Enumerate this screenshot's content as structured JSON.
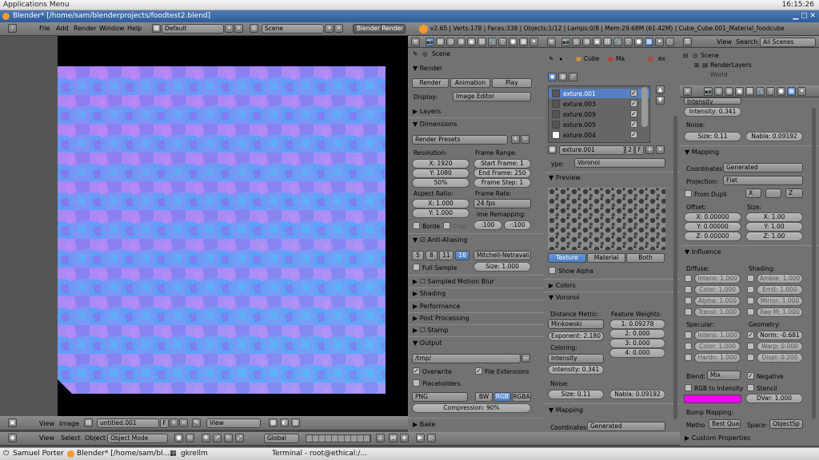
{
  "top_panel": {
    "applications_menu": "Applications Menu",
    "clock": "16:15:26"
  },
  "window": {
    "title": "Blender* [/home/sam/blenderprojects/foodtest2.blend]"
  },
  "menu": {
    "file": "File",
    "add": "Add",
    "render": "Render",
    "window": "Window",
    "help": "Help",
    "layout": "Default",
    "scene": "Scene",
    "engine": "Blender Render",
    "stats": "v2.65 | Verts:178 | Faces:338 | Objects:1/12 | Lamps:0/8 | Mem:29.68M (61.42M) | Cube_Cube.001_Material_foodcube"
  },
  "image_editor_header": {
    "view": "View",
    "image": "Image",
    "image_name": "untitled.001",
    "f": "F",
    "view2": "View"
  },
  "view3d_header": {
    "view": "View",
    "select": "Select",
    "object": "Object",
    "mode": "Object Mode",
    "orientation": "Global"
  },
  "render_panel": {
    "breadcrumb": "Scene",
    "render_title": "Render",
    "render_btn": "Render",
    "animation_btn": "Animation",
    "play_btn": "Play",
    "display_label": "Display:",
    "display_value": "Image Editor",
    "layers": "Layers",
    "dimensions": "Dimensions",
    "presets": "Render Presets",
    "resolution_label": "Resolution:",
    "res_x": "X: 1920",
    "res_y": "Y: 1080",
    "res_pct": "50%",
    "frame_range_label": "Frame Range:",
    "start_frame": "Start Frame: 1",
    "end_frame": "End Frame: 250",
    "frame_step": "Frame Step: 1",
    "aspect_label": "Aspect Ratio:",
    "aspect_x": "X: 1.000",
    "aspect_y": "Y: 1.000",
    "frame_rate_label": "Frame Rate:",
    "fps": "24 fps",
    "time_remap_label": "ime Remapping:",
    "remap_old": ":100",
    "remap_new": "·:100",
    "border": "Borde",
    "crop": "Crop",
    "aa": "Anti-Aliasing",
    "aa5": "5",
    "aa8": "8",
    "aa11": "11",
    "aa16": "16",
    "aa_filter": "Mitchell-Netravali",
    "full_sample": "Full Sample",
    "aa_size": "Size: 1.000",
    "motion_blur": "Sampled Motion Blur",
    "shading": "Shading",
    "performance": "Performance",
    "post": "Post Processing",
    "stamp": "Stamp",
    "output": "Output",
    "output_path": "/tmp/",
    "overwrite": "Overwrite",
    "file_ext": "File Extensions",
    "placeholders": "Placeholders",
    "format": "PNG",
    "bw": "BW",
    "rgb": "RGB",
    "rgba": "RGBA",
    "compression": "Compression: 90%",
    "bake": "Bake"
  },
  "texture_panel": {
    "breadcrumb_cube": "Cube",
    "breadcrumb_ma": "Ma",
    "breadcrumb_ex": "ex",
    "slots": [
      "exture.001",
      "exture.003",
      "exture.009",
      "exture.005",
      "exture.004"
    ],
    "tex_name": "exture.001",
    "users": "2",
    "f": "F",
    "type_label": "ype:",
    "type_value": "Voronoi",
    "preview": "Preview",
    "tab_texture": "Texture",
    "tab_material": "Material",
    "tab_both": "Both",
    "show_alpha": "Show Alpha",
    "colors": "Colors",
    "voronoi": "Voronoi",
    "distance_label": "Distance Metric:",
    "distance_value": "Minkowski",
    "exponent": "Exponent: 2.180",
    "coloring_label": "Coloring:",
    "coloring_value": "Intensity",
    "intensity": "Intensity: 0.341",
    "weights_label": "Feature Weights:",
    "w1": "1: 0.09278",
    "w2": "2: 0.000",
    "w3": "3: 0.000",
    "w4": "4: 0.000",
    "noise_label": "Noise:",
    "size": "Size: 0.11",
    "nabla": "Nabla: 0.09192",
    "mapping": "Mapping",
    "coordinates_label": "Coordinates:",
    "coordinates_value": "Generated"
  },
  "outliner": {
    "view": "View",
    "search": "Search",
    "all_scenes": "All Scenes",
    "scene": "Scene",
    "render_layers": "RenderLayers",
    "world": "World"
  },
  "props_right": {
    "intensity_top": "Intensity",
    "intensity": "Intensity: 0.341",
    "noise_label": "Noise:",
    "size": "Size: 0.11",
    "nabla": "Nabla: 0.09192",
    "mapping": "Mapping",
    "coordinates_label": "Coordinates:",
    "coordinates_value": "Generated",
    "projection_label": "Projection:",
    "projection_value": "Flat",
    "from_dupli": "From Dupli",
    "x": "X",
    "y": "",
    "z": "Z",
    "offset_label": "Offset:",
    "off_x": "X: 0.00000",
    "off_y": "Y: 0.00000",
    "off_z": "Z: 0.00000",
    "size_label": "Size:",
    "size_x": "X: 1.00",
    "size_y": "Y: 1.00",
    "size_z": "Z: 1.00",
    "influence": "Influence",
    "diffuse_label": "Diffuse:",
    "shading_label": "Shading:",
    "d_intens": "Intens: 1.000",
    "d_color": "Color: 1.000",
    "d_alpha": "Alpha: 1.000",
    "d_transl": "Transl: 1.000",
    "s_ambi": "Ambie: 1.000",
    "s_emit": "Emit: 1.000",
    "s_mirror": "Mirror: 1.000",
    "s_raym": "Ray M: 1.000",
    "specular_label": "Specular:",
    "geometry_label": "Geometry:",
    "sp_intens": "Intens: 1.000",
    "sp_color": "Color: 1.000",
    "sp_hard": "Hardn: 1.000",
    "g_norm": "Norm: -0.681",
    "g_warp": "Warp: 0.000",
    "g_displ": "Displ: 0.200",
    "blend_label": "Blend:",
    "blend_value": "Mix",
    "negative": "Negative",
    "rgb_to_int": "RGB to Intensity",
    "stencil": "Stencil",
    "dvar": "DVar: 1.000",
    "bump_label": "Bump Mapping:",
    "method_label": "Metho",
    "method_value": "Best Qual",
    "space_label": "Space:",
    "space_value": "ObjectSp",
    "custom_props": "Custom Properties",
    "swatch_color": "#ff00ff"
  },
  "taskbar": {
    "user": "Samuel Porter",
    "t1": "Blender* [/home/sam/bl...",
    "t2": "gkrellm",
    "t3": "Terminal - root@ethical:/..."
  }
}
